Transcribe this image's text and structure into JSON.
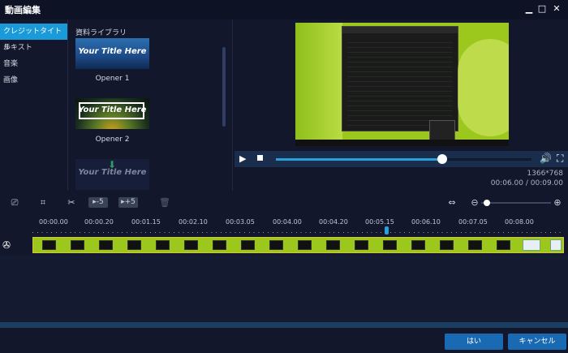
{
  "window": {
    "title": "動画編集",
    "minimize": "▁",
    "maximize": "□",
    "close": "✕"
  },
  "sidebar": {
    "items": [
      {
        "label": "クレジットタイトル",
        "active": true
      },
      {
        "label": "テキスト",
        "active": false
      },
      {
        "label": "音楽",
        "active": false
      },
      {
        "label": "画像",
        "active": false
      }
    ]
  },
  "library": {
    "title": "資料ライブラリ",
    "items": [
      {
        "thumb_text": "Your Title Here",
        "caption": "Opener 1"
      },
      {
        "thumb_text": "Your Title Here",
        "caption": "Opener 2"
      },
      {
        "thumb_text": "Your Title Here",
        "caption": ""
      }
    ]
  },
  "player": {
    "resolution": "1366*768",
    "timecode": "00:06.00 / 00:09.00",
    "progress": 0.65
  },
  "toolbar": {
    "speed_down": "▸-5",
    "speed_up": "▸+5"
  },
  "timeline": {
    "ticks": [
      "00:00.00",
      "00:00.20",
      "00:01.15",
      "00:02.10",
      "00:03.05",
      "00:04.00",
      "00:04.20",
      "00:05.15",
      "00:06.10",
      "00:07.05",
      "00:08.00"
    ]
  },
  "footer": {
    "ok": "はい",
    "cancel": "キャンセル"
  },
  "colors": {
    "accent": "#1a9ad8",
    "background": "#12172b",
    "button": "#1a6ab3",
    "clip": "#9cc81e"
  }
}
